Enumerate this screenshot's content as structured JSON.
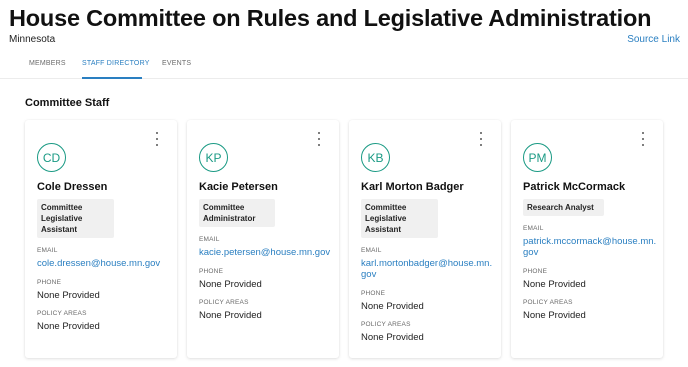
{
  "header": {
    "title": "House Committee on Rules and Legislative Administration",
    "subtitle": "Minnesota",
    "source_link": "Source Link"
  },
  "tabs": [
    {
      "label": "MEMBERS",
      "active": false
    },
    {
      "label": "STAFF DIRECTORY",
      "active": true
    },
    {
      "label": "EVENTS",
      "active": false
    }
  ],
  "section_title": "Committee Staff",
  "field_labels": {
    "email": "EMAIL",
    "phone": "PHONE",
    "policy_areas": "POLICY AREAS"
  },
  "staff": [
    {
      "initials": "CD",
      "name": "Cole Dressen",
      "role_lines": [
        "Committee",
        "Legislative",
        "Assistant"
      ],
      "email_lines": [
        "cole.dressen@house.mn.gov"
      ],
      "phone": "None Provided",
      "policy_areas": "None Provided"
    },
    {
      "initials": "KP",
      "name": "Kacie Petersen",
      "role_lines": [
        "Committee",
        "Administrator"
      ],
      "email_lines": [
        "kacie.petersen@house.mn.gov"
      ],
      "phone": "None Provided",
      "policy_areas": "None Provided"
    },
    {
      "initials": "KB",
      "name": "Karl Morton Badger",
      "role_lines": [
        "Committee",
        "Legislative",
        "Assistant"
      ],
      "email_lines": [
        "karl.mortonbadger@house.mn.",
        "gov"
      ],
      "phone": "None Provided",
      "policy_areas": "None Provided"
    },
    {
      "initials": "PM",
      "name": "Patrick McCormack",
      "role_lines": [
        "Research Analyst"
      ],
      "email_lines": [
        "patrick.mccormack@house.mn.",
        "gov"
      ],
      "phone": "None Provided",
      "policy_areas": "None Provided"
    }
  ],
  "colors": {
    "accent": "#2a7fc1",
    "avatar": "#1a9a84",
    "role_bg": "#f0f0f0"
  }
}
